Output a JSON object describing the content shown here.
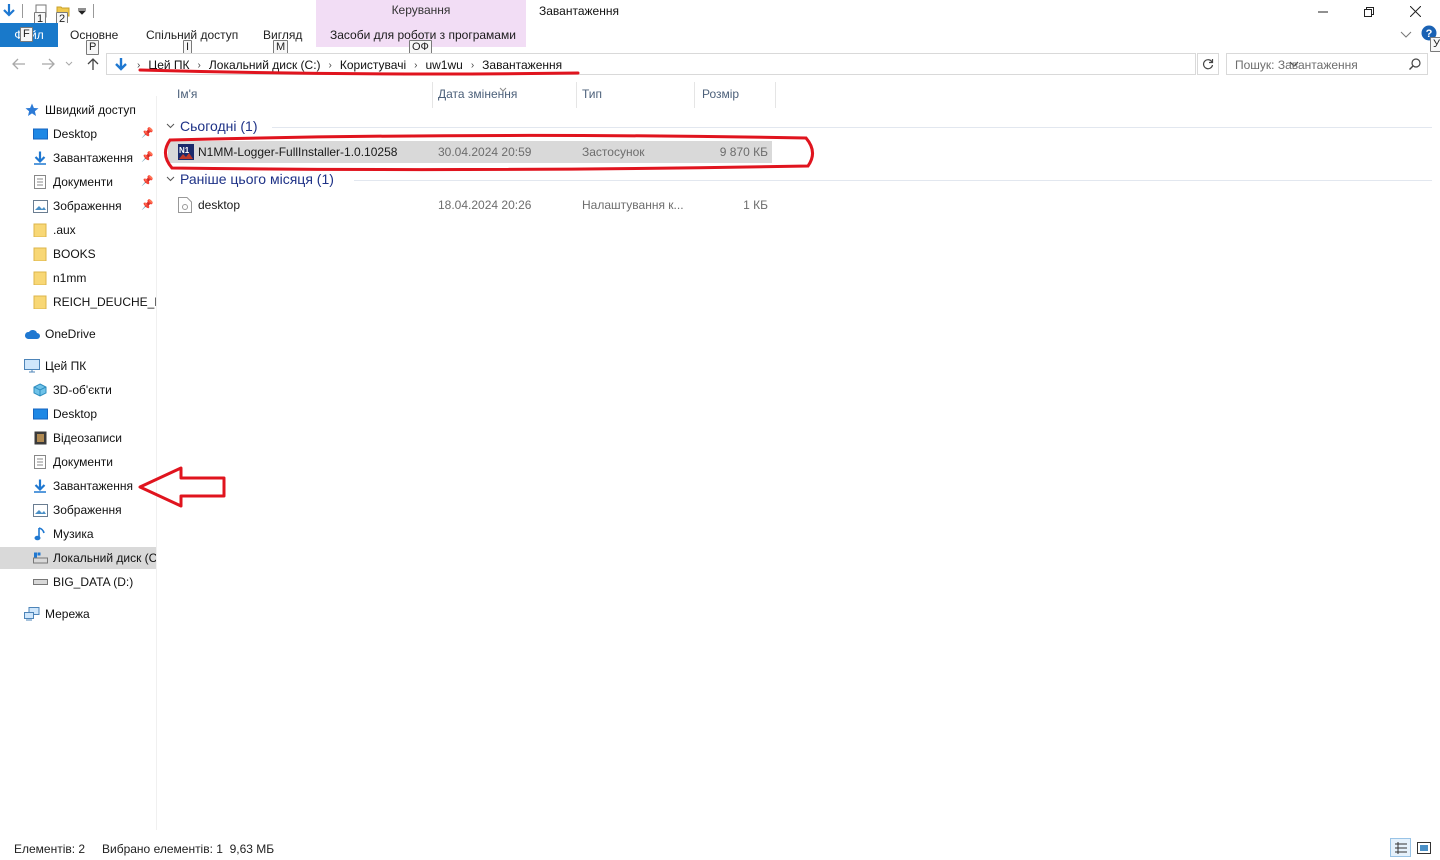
{
  "window": {
    "title": "Завантаження",
    "context_tab_header": "Керування"
  },
  "quick_access_toolbar": {
    "keytips": [
      "1",
      "2"
    ]
  },
  "ribbon": {
    "file_tab": "Файл",
    "file_keytip": "F",
    "tabs": [
      {
        "label": "Основне",
        "keytip": "P"
      },
      {
        "label": "Спільний доступ",
        "keytip": "І"
      },
      {
        "label": "Вигляд",
        "keytip": "M"
      },
      {
        "label": "Засоби для роботи з програмами",
        "keytip": "ОФ"
      }
    ],
    "help_keytip": "У"
  },
  "address": {
    "crumbs": [
      "Цей ПК",
      "Локальний диск (C:)",
      "Користувачі",
      "uw1wu",
      "Завантаження"
    ],
    "search_placeholder": "Пошук: Завантаження"
  },
  "nav": {
    "quick_access": "Швидкий доступ",
    "quick_items": [
      "Desktop",
      "Завантаження",
      "Документи",
      "Зображення",
      ".aux",
      "BOOKS",
      "n1mm",
      "REICH_DEUCHE_MU"
    ],
    "onedrive": "OneDrive",
    "this_pc": "Цей ПК",
    "pc_items": [
      "3D-об'єкти",
      "Desktop",
      "Відеозаписи",
      "Документи",
      "Завантаження",
      "Зображення",
      "Музика",
      "Локальний диск (C:)",
      "BIG_DATA (D:)"
    ],
    "network": "Мережа"
  },
  "columns": {
    "name": "Ім'я",
    "date": "Дата змінення",
    "type": "Тип",
    "size": "Розмір"
  },
  "groups": [
    {
      "header": "Сьогодні (1)",
      "files": [
        {
          "name": "N1MM-Logger-FullInstaller-1.0.10258",
          "date": "30.04.2024 20:59",
          "type": "Застосунок",
          "size": "9 870 КБ",
          "selected": true
        }
      ]
    },
    {
      "header": "Раніше цього місяця (1)",
      "files": [
        {
          "name": "desktop",
          "date": "18.04.2024 20:26",
          "type": "Налаштування к...",
          "size": "1 КБ",
          "selected": false
        }
      ]
    }
  ],
  "status": {
    "items_count": "Елементів: 2",
    "selected": "Вибрано елементів: 1  9,63 МБ"
  },
  "colors": {
    "accent": "#1979ca",
    "context_tab": "#f2ddf5",
    "selection": "#d9d9d9",
    "annotation": "#e0141e",
    "group_header": "#1e3287"
  }
}
